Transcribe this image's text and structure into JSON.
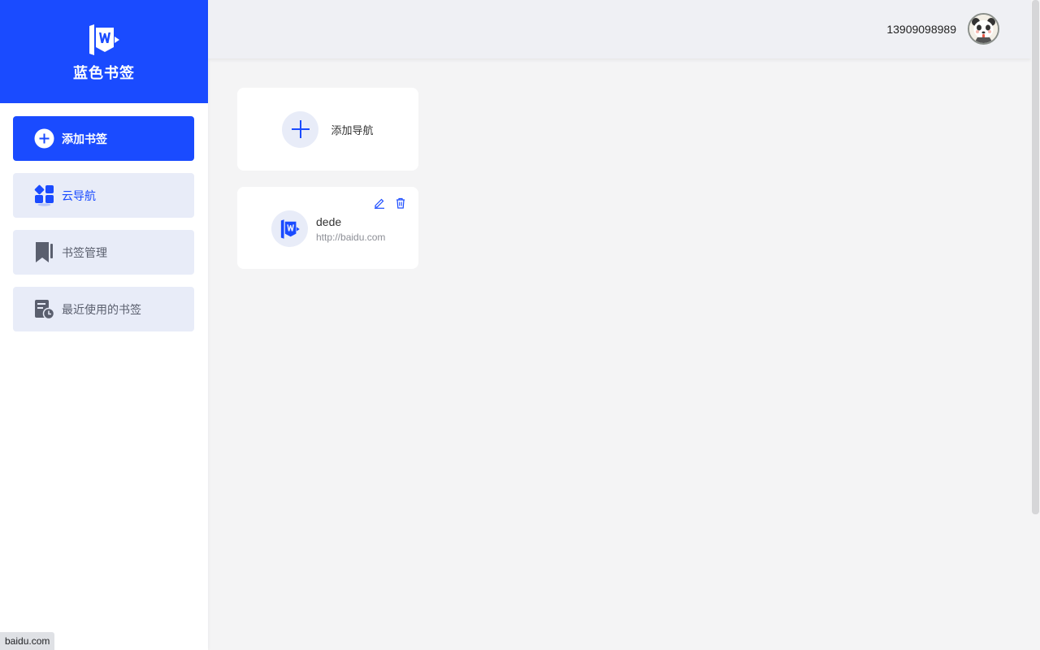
{
  "brand": {
    "name": "蓝色书签",
    "logo_icon": "bookmark-logo-icon",
    "color": "#1a4bff"
  },
  "sidebar": {
    "items": [
      {
        "label": "添加书签",
        "icon": "plus-circle-icon"
      },
      {
        "label": "云导航",
        "icon": "grid-apps-icon"
      },
      {
        "label": "书签管理",
        "icon": "bookmark-icon"
      },
      {
        "label": "最近使用的书签",
        "icon": "document-clock-icon"
      }
    ]
  },
  "header": {
    "phone": "13909098989",
    "avatar_icon": "panda-avatar"
  },
  "main": {
    "add_card": {
      "label": "添加导航",
      "icon": "plus-icon"
    },
    "bookmarks": [
      {
        "title": "dede",
        "url": "http://baidu.com",
        "icon": "bookmark-logo-icon"
      }
    ]
  },
  "status_bar": {
    "text": "baidu.com"
  }
}
